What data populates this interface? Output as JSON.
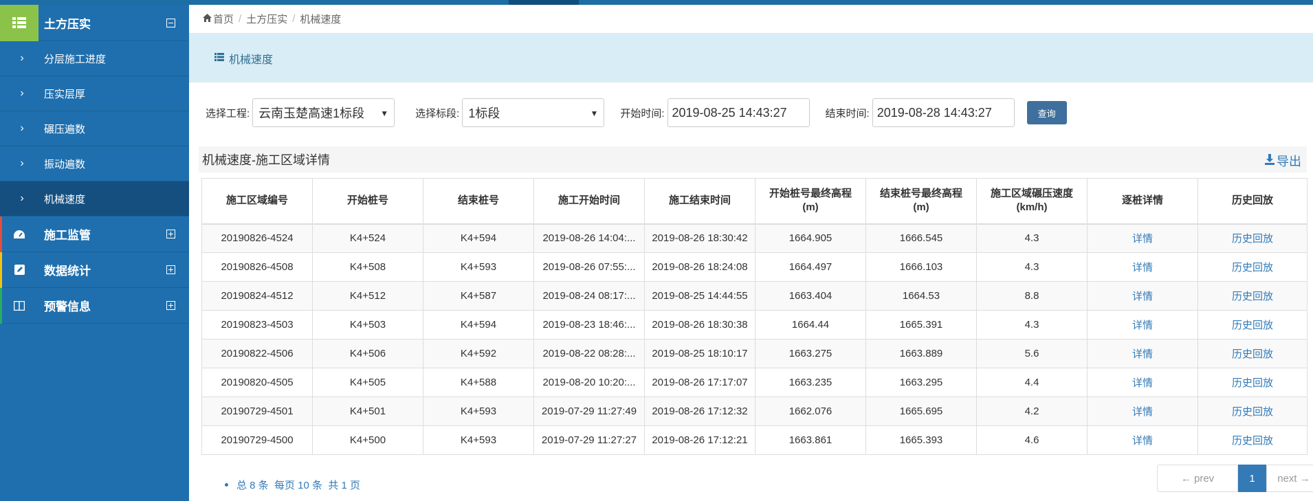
{
  "colors": {
    "accent": "#337ab7",
    "sidebar": "#1f6fae",
    "sidebar_active": "#154f80",
    "header_icon": "#8bc34a"
  },
  "sidebar": {
    "title": "土方压实",
    "sub_items": [
      {
        "label": "分层施工进度"
      },
      {
        "label": "压实层厚"
      },
      {
        "label": "碾压遍数"
      },
      {
        "label": "振动遍数"
      },
      {
        "label": "机械速度",
        "active": true
      }
    ],
    "groups": [
      {
        "label": "施工监管",
        "icon": "dashboard-icon",
        "color": "#e74c3c"
      },
      {
        "label": "数据统计",
        "icon": "edit-icon",
        "color": "#f1c40f"
      },
      {
        "label": "预警信息",
        "icon": "columns-icon",
        "color": "#27ae60"
      }
    ]
  },
  "breadcrumb": {
    "home": "首页",
    "level1": "土方压实",
    "level2": "机械速度"
  },
  "panel": {
    "title": "机械速度"
  },
  "filters": {
    "project_label": "选择工程:",
    "project_value": "云南玉楚高速1标段",
    "section_label": "选择标段:",
    "section_value": "1标段",
    "start_label": "开始时间:",
    "start_value": "2019-08-25 14:43:27",
    "end_label": "结束时间:",
    "end_value": "2019-08-28 14:43:27",
    "query_button": "查询"
  },
  "section": {
    "title": "机械速度-施工区域详情",
    "export_label": "导出"
  },
  "table": {
    "headers": [
      "施工区域编号",
      "开始桩号",
      "结束桩号",
      "施工开始时间",
      "施工结束时间",
      "开始桩号最终高程(m)",
      "结束桩号最终高程(m)",
      "施工区域碾压速度(km/h)",
      "逐桩详情",
      "历史回放"
    ],
    "rows": [
      [
        "20190826-4524",
        "K4+524",
        "K4+594",
        "2019-08-26 14:04:...",
        "2019-08-26 18:30:42",
        "1664.905",
        "1666.545",
        "4.3",
        "详情",
        "历史回放"
      ],
      [
        "20190826-4508",
        "K4+508",
        "K4+593",
        "2019-08-26 07:55:...",
        "2019-08-26 18:24:08",
        "1664.497",
        "1666.103",
        "4.3",
        "详情",
        "历史回放"
      ],
      [
        "20190824-4512",
        "K4+512",
        "K4+587",
        "2019-08-24 08:17:...",
        "2019-08-25 14:44:55",
        "1663.404",
        "1664.53",
        "8.8",
        "详情",
        "历史回放"
      ],
      [
        "20190823-4503",
        "K4+503",
        "K4+594",
        "2019-08-23 18:46:...",
        "2019-08-26 18:30:38",
        "1664.44",
        "1665.391",
        "4.3",
        "详情",
        "历史回放"
      ],
      [
        "20190822-4506",
        "K4+506",
        "K4+592",
        "2019-08-22 08:28:...",
        "2019-08-25 18:10:17",
        "1663.275",
        "1663.889",
        "5.6",
        "详情",
        "历史回放"
      ],
      [
        "20190820-4505",
        "K4+505",
        "K4+588",
        "2019-08-20 10:20:...",
        "2019-08-26 17:17:07",
        "1663.235",
        "1663.295",
        "4.4",
        "详情",
        "历史回放"
      ],
      [
        "20190729-4501",
        "K4+501",
        "K4+593",
        "2019-07-29 11:27:49",
        "2019-08-26 17:12:32",
        "1662.076",
        "1665.695",
        "4.2",
        "详情",
        "历史回放"
      ],
      [
        "20190729-4500",
        "K4+500",
        "K4+593",
        "2019-07-29 11:27:27",
        "2019-08-26 17:12:21",
        "1663.861",
        "1665.393",
        "4.6",
        "详情",
        "历史回放"
      ]
    ]
  },
  "pagination": {
    "summary": "总 8 条  每页 10 条  共 1 页",
    "prev": "← prev",
    "current": "1",
    "next": "next →"
  }
}
